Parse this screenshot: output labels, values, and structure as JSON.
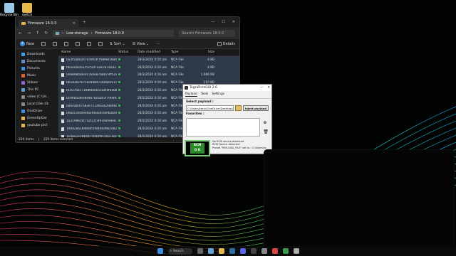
{
  "desktop": {
    "icons": [
      {
        "label": "Recycle Bin"
      },
      {
        "label": "switch"
      }
    ]
  },
  "explorer": {
    "tab_title": "Firmware 18.0.0",
    "address": [
      "Low storage",
      "Firmware 18.0.0"
    ],
    "search_placeholder": "Search Firmware 18.0.0",
    "toolbar": {
      "new": "New",
      "sort": "Sort",
      "view": "View",
      "details": "Details"
    },
    "sidebar": [
      {
        "label": "Downloads",
        "color": "#3aa0e8"
      },
      {
        "label": "Documents",
        "color": "#6a8bd8"
      },
      {
        "label": "Pictures",
        "color": "#3a8ee6"
      },
      {
        "label": "Music",
        "color": "#e06030"
      },
      {
        "label": "Videos",
        "color": "#9060d0"
      },
      {
        "label": "This PC",
        "color": "#58a0d8"
      },
      {
        "label": "video (C:\\Us...",
        "color": "#888888"
      },
      {
        "label": "Local Disk (D:",
        "color": "#888888"
      },
      {
        "label": "OneDrive",
        "color": "#3a8ee6"
      },
      {
        "label": "GreenUpGar",
        "color": "#e8b84a"
      },
      {
        "label": "youtube pict",
        "color": "#e8b84a"
      }
    ],
    "columns": [
      "Name",
      "Status",
      "Date modified",
      "Type",
      "Size"
    ],
    "rows": [
      {
        "name": "0a3f5a802e7a59fc4f7f8998168d47...nca",
        "date": "28/3/2024 4:16 am",
        "type": "NCA File",
        "size": "4 KB"
      },
      {
        "name": "0b5ee4efe1c5c5af74a67b74ed27f5f0...nca",
        "date": "28/3/2024 4:16 am",
        "type": "NCA File",
        "size": "4 KB"
      },
      {
        "name": "0e9898fade0c76de87b8d79ff5c9cc5b.nca",
        "date": "28/3/2024 4:16 am",
        "type": "NCA File",
        "size": "1,086 KB"
      },
      {
        "name": "0b18361fe75ec8a8472896e021d6c3ed.nca",
        "date": "28/3/2024 4:16 am",
        "type": "NCA File",
        "size": "115 KB"
      },
      {
        "name": "0c0376bc7368f8eb65ca4f4f0a0b29...nca",
        "date": "28/3/2024 4:16 am",
        "type": "NCA File",
        "size": ""
      },
      {
        "name": "0c9fd4a46e8a9e7bc6d47f7908f0c5291.nca",
        "date": "28/3/2024 4:16 am",
        "type": "NCA File",
        "size": ""
      },
      {
        "name": "0a6eabf07a83e71146ea629b96e79e3e.nca",
        "date": "28/3/2024 4:16 am",
        "type": "NCA File",
        "size": ""
      },
      {
        "name": "0f6b510d0e4fb4fde40fc0efb2bde.nca",
        "date": "28/3/2024 4:16 am",
        "type": "NCA File",
        "size": ""
      },
      {
        "name": "1a31986c6f742f21f3f919afe4eb.nca",
        "date": "28/3/2024 4:16 am",
        "type": "NCA File",
        "size": ""
      },
      {
        "name": "1d0d28a1b9bb0f1f8466d9b2d82f6e2.nca",
        "date": "28/3/2024 4:16 am",
        "type": "NCA File",
        "size": ""
      },
      {
        "name": "1e48e2e1864d750d4f9c1ba7ebc111.nca",
        "date": "28/3/2024 4:16 am",
        "type": "NCA File",
        "size": ""
      }
    ],
    "status_items": "229 items",
    "status_selected": "229 items selected"
  },
  "tegra": {
    "title": "TegraRcmGUI 2.6",
    "tabs": [
      "Payload",
      "Tools",
      "Settings"
    ],
    "select_label": "Select payload :",
    "payload_path": "C:\\Users\\terry\\OneDrive\\Desktop\\switch fin",
    "inject_label": "Inject payload",
    "favorites_label": "Favorites :",
    "rcm_text": [
      "RCM",
      "O K"
    ],
    "log": [
      "No RCM device detected",
      "RCM Device detected",
      "Preset \"PAYLOAD_FILE\" set to : C:\\Users\\te"
    ]
  },
  "taskbar": {
    "search_label": "Search",
    "icons": [
      {
        "name": "start",
        "color": "#3a8ee6"
      },
      {
        "name": "taskview",
        "color": "#666666"
      },
      {
        "name": "widgets",
        "color": "#6aa0d8"
      },
      {
        "name": "explorer",
        "color": "#e8b84a"
      },
      {
        "name": "steam",
        "color": "#2a6ea8"
      },
      {
        "name": "discord",
        "color": "#5865f2"
      },
      {
        "name": "obs",
        "color": "#444444"
      },
      {
        "name": "settings",
        "color": "#888888"
      },
      {
        "name": "chrome",
        "color": "#d44"
      },
      {
        "name": "app-green",
        "color": "#3a9a4a"
      },
      {
        "name": "tegra",
        "color": "#aaaaaa"
      }
    ]
  }
}
